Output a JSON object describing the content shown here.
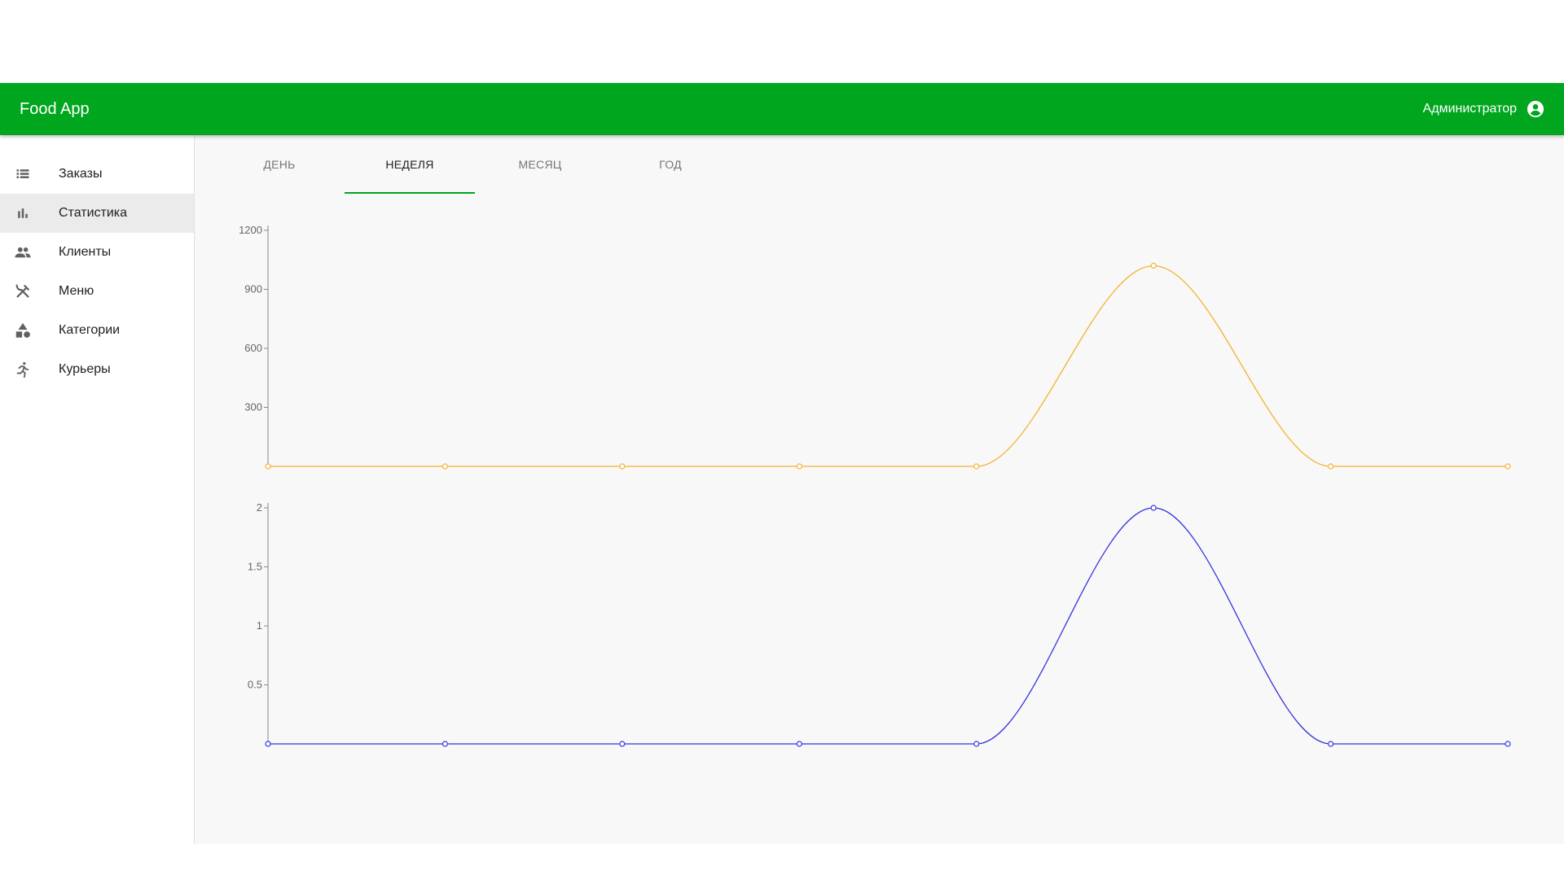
{
  "app": {
    "title": "Food App",
    "user_name": "Администратор",
    "brand_color": "#00a61e"
  },
  "sidebar": {
    "items": [
      {
        "label": "Заказы",
        "icon": "list-icon",
        "active": false
      },
      {
        "label": "Статистика",
        "icon": "bar-chart-icon",
        "active": true
      },
      {
        "label": "Клиенты",
        "icon": "people-icon",
        "active": false
      },
      {
        "label": "Меню",
        "icon": "fork-knife-icon",
        "active": false
      },
      {
        "label": "Категории",
        "icon": "shapes-icon",
        "active": false
      },
      {
        "label": "Курьеры",
        "icon": "runner-icon",
        "active": false
      }
    ]
  },
  "tabs": {
    "items": [
      "ДЕНЬ",
      "НЕДЕЛЯ",
      "МЕСЯЦ",
      "ГОД"
    ],
    "active_index": 1
  },
  "chart_data": [
    {
      "type": "line",
      "x": [
        1,
        2,
        3,
        4,
        5,
        6,
        7,
        8
      ],
      "values": [
        0,
        0,
        0,
        0,
        0,
        1020,
        0,
        0
      ],
      "yticks": [
        "300",
        "600",
        "900",
        "1200"
      ],
      "ylim": [
        0,
        1200
      ],
      "color": "#f5b22e",
      "curve": "smooth",
      "markers": true,
      "grid": false
    },
    {
      "type": "line",
      "x": [
        1,
        2,
        3,
        4,
        5,
        6,
        7,
        8
      ],
      "values": [
        0,
        0,
        0,
        0,
        0,
        2,
        0,
        0
      ],
      "yticks": [
        "0.5",
        "1",
        "1.5",
        "2"
      ],
      "ylim": [
        0,
        2
      ],
      "color": "#3333dd",
      "curve": "smooth",
      "markers": true,
      "grid": false
    }
  ]
}
